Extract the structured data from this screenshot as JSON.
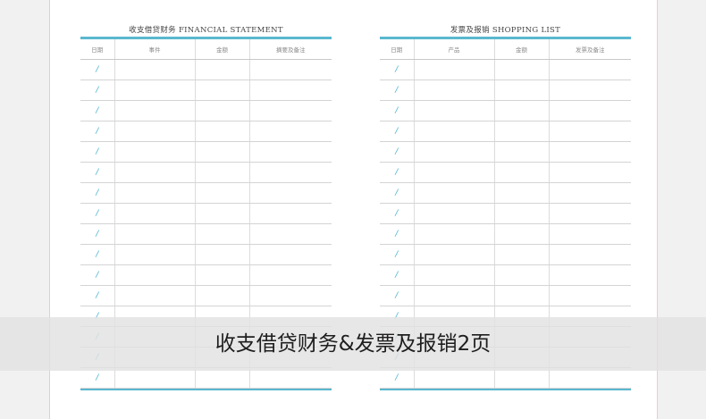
{
  "left_sheet": {
    "title": "收支借贷财务 FINANCIAL STATEMENT",
    "columns": [
      "日期",
      "事件",
      "金额",
      "摘要及备注"
    ],
    "date_mark": "/"
  },
  "right_sheet": {
    "title": "发票及报销 SHOPPING LIST",
    "columns": [
      "日期",
      "产品",
      "金额",
      "发票及备注"
    ],
    "date_mark": "/"
  },
  "banner": {
    "text": "收支借贷财务&发票及报销2页"
  },
  "colors": {
    "accent": "#5ab8cf",
    "page_background": "#f1f1f1",
    "sheet_background": "#ffffff"
  }
}
